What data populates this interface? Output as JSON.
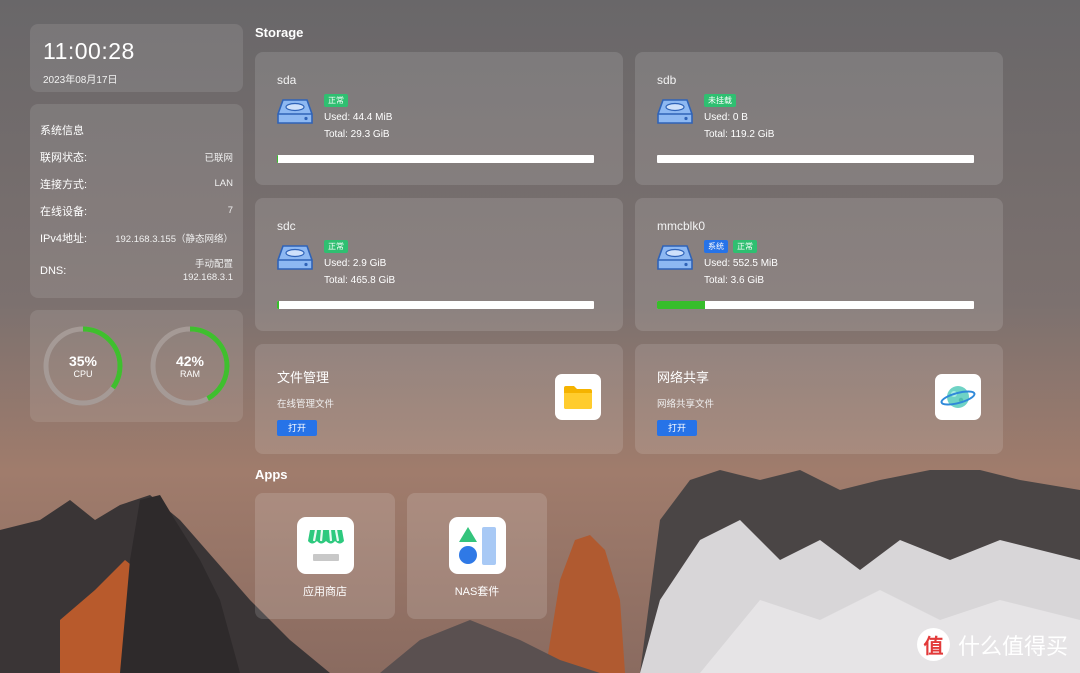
{
  "clock": {
    "time": "11:00:28",
    "date": "2023年08月17日"
  },
  "sysinfo": {
    "title": "系统信息",
    "rows": [
      {
        "label": "联网状态:",
        "value": "已联网"
      },
      {
        "label": "连接方式:",
        "value": "LAN"
      },
      {
        "label": "在线设备:",
        "value": "7"
      },
      {
        "label": "IPv4地址:",
        "value": "192.168.3.155（静态网络）"
      }
    ],
    "dns": {
      "label": "DNS:",
      "line1": "手动配置",
      "line2": "192.168.3.1"
    }
  },
  "gauges": {
    "cpu": {
      "value": "35%",
      "label": "CPU",
      "fraction": 0.35
    },
    "ram": {
      "value": "42%",
      "label": "RAM",
      "fraction": 0.42
    }
  },
  "storage": {
    "title": "Storage",
    "disks": [
      {
        "name": "sda",
        "badges": [
          "正常"
        ],
        "used": "Used: 44.4 MiB",
        "total": "Total: 29.3 GiB",
        "fraction": 0.0015
      },
      {
        "name": "sdb",
        "badges": [
          "未挂载"
        ],
        "used": "Used: 0 B",
        "total": "Total: 119.2 GiB",
        "fraction": 0
      },
      {
        "name": "sdc",
        "badges": [
          "正常"
        ],
        "used": "Used: 2.9 GiB",
        "total": "Total: 465.8 GiB",
        "fraction": 0.006
      },
      {
        "name": "mmcblk0",
        "badges": [
          "系统",
          "正常"
        ],
        "used": "Used: 552.5 MiB",
        "total": "Total: 3.6 GiB",
        "fraction": 0.15
      }
    ]
  },
  "features": [
    {
      "title": "文件管理",
      "subtitle": "在线管理文件",
      "button": "打开",
      "icon": "folder-icon"
    },
    {
      "title": "网络共享",
      "subtitle": "网络共享文件",
      "button": "打开",
      "icon": "planet-icon"
    }
  ],
  "apps": {
    "title": "Apps",
    "items": [
      {
        "name": "应用商店",
        "icon": "store-icon"
      },
      {
        "name": "NAS套件",
        "icon": "nas-suite-icon"
      }
    ]
  },
  "watermark": {
    "glyph": "值",
    "text": "什么值得买"
  },
  "colors": {
    "badge_normal": "#2fbf71",
    "badge_system": "#2673e8",
    "progress_fill": "#37bd2b",
    "gauge_track": "#a59a96",
    "gauge_fill": "#3fbf2e",
    "button": "#2673e8"
  }
}
